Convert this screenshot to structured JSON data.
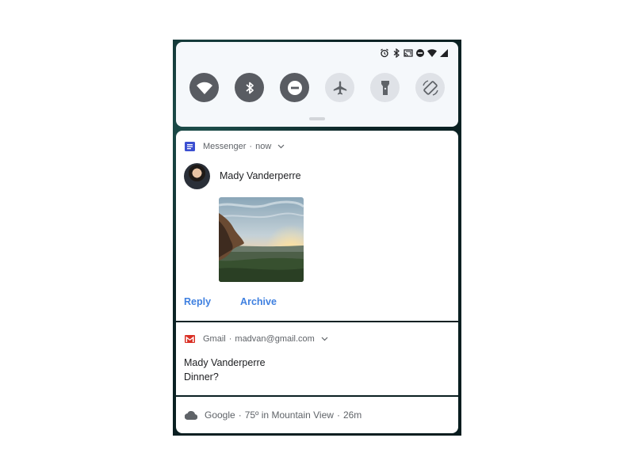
{
  "quick_settings": {
    "status_icons": [
      "alarm-icon",
      "bluetooth-icon",
      "cast-icon",
      "dnd-icon",
      "wifi-icon",
      "signal-icon"
    ],
    "tiles": [
      {
        "name": "wifi",
        "state": "on"
      },
      {
        "name": "bluetooth",
        "state": "on"
      },
      {
        "name": "do-not-disturb",
        "state": "on"
      },
      {
        "name": "airplane-mode",
        "state": "off"
      },
      {
        "name": "flashlight",
        "state": "off"
      },
      {
        "name": "auto-rotate",
        "state": "off"
      }
    ]
  },
  "messenger": {
    "app": "Messenger",
    "time": "now",
    "sender": "Mady Vanderperre",
    "actions": {
      "reply": "Reply",
      "archive": "Archive"
    },
    "accent": "#3f80e0",
    "icon_color": "#3b4fd1"
  },
  "gmail": {
    "app": "Gmail",
    "account": "madvan@gmail.com",
    "sender": "Mady Vanderperre",
    "message": "Dinner?",
    "icon_color": "#d93025"
  },
  "google": {
    "app": "Google",
    "weather": "75º in Mountain View",
    "time": "26m"
  }
}
